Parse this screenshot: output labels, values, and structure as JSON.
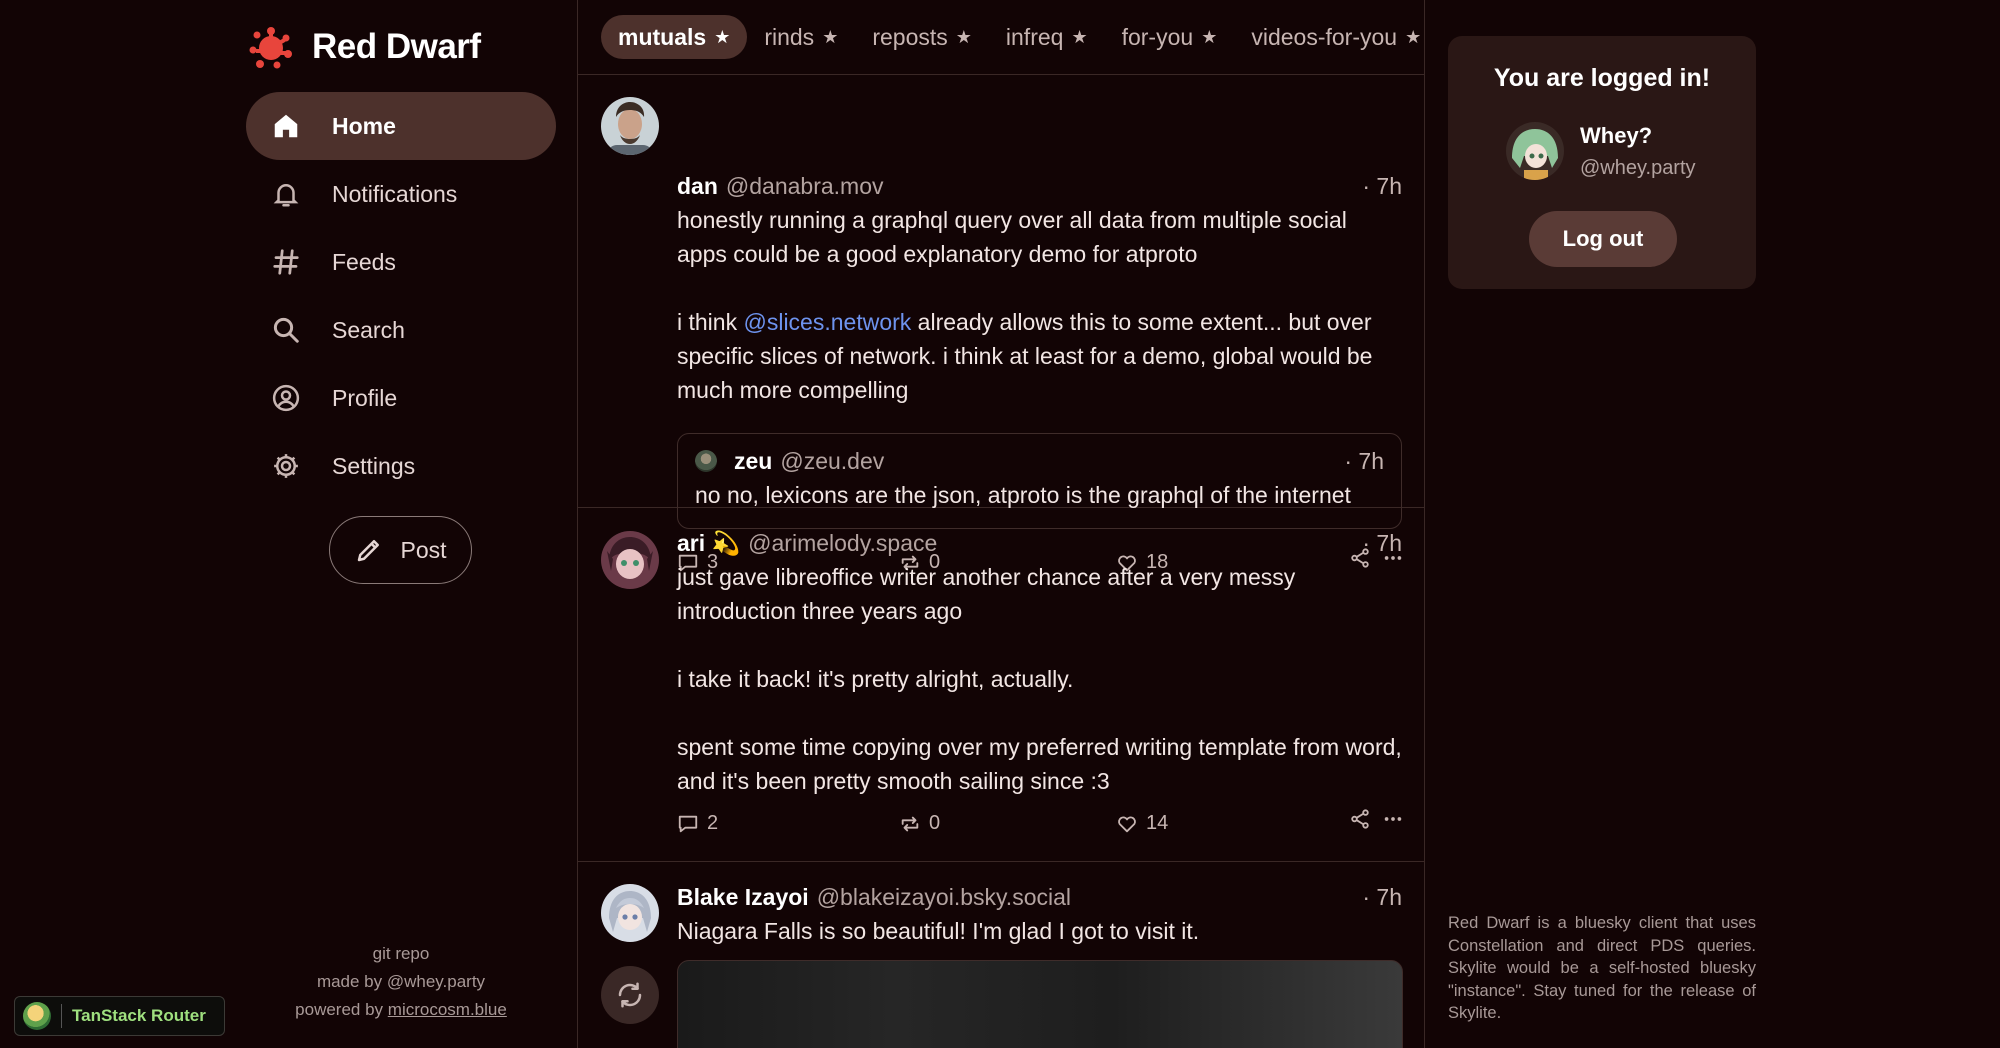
{
  "brand": {
    "name": "Red Dwarf"
  },
  "nav": {
    "items": [
      {
        "label": "Home",
        "icon": "home-icon",
        "active": true
      },
      {
        "label": "Notifications",
        "icon": "bell-icon"
      },
      {
        "label": "Feeds",
        "icon": "hashtag-icon"
      },
      {
        "label": "Search",
        "icon": "search-icon"
      },
      {
        "label": "Profile",
        "icon": "user-circle-icon"
      },
      {
        "label": "Settings",
        "icon": "gear-icon"
      }
    ],
    "post_label": "Post"
  },
  "footer": {
    "git_repo": "git repo",
    "made_by": "made by @whey.party",
    "powered_by": "powered by",
    "powered_link": "microcosm.blue"
  },
  "devtools": {
    "label": "TanStack Router"
  },
  "tabs": [
    {
      "label": "mutuals",
      "active": true
    },
    {
      "label": "rinds"
    },
    {
      "label": "reposts"
    },
    {
      "label": "infreq"
    },
    {
      "label": "for-you"
    },
    {
      "label": "videos-for-you"
    }
  ],
  "posts": [
    {
      "name": "dan",
      "handle": "@danabra.mov",
      "time": "· 7h",
      "text1": "honestly running a graphql query over all data from multiple social apps could be a good explanatory demo for atproto",
      "text2_pre": "i think ",
      "text2_mention": "@slices.network",
      "text2_post": " already allows this to some extent... but over specific slices of network. i think at least for a demo, global would be much more compelling",
      "quote": {
        "name": "zeu",
        "handle": "@zeu.dev",
        "time": "· 7h",
        "text": "no no, lexicons are the json, atproto is the graphql of the internet"
      },
      "replies": "3",
      "reposts": "0",
      "likes": "18"
    },
    {
      "name": "ari 💫",
      "handle": "@arimelody.space",
      "time": "· 7h",
      "text1": "just gave libreoffice writer another chance after a very messy introduction three years ago",
      "text2": "i take it back! it's pretty alright, actually.",
      "text3": "spent some time copying over my preferred writing template from word, and it's been pretty smooth sailing since :3",
      "replies": "2",
      "reposts": "0",
      "likes": "14"
    },
    {
      "name": "Blake Izayoi",
      "handle": "@blakeizayoi.bsky.social",
      "time": "· 7h",
      "text1": "Niagara Falls is so beautiful! I'm glad I got to visit it."
    }
  ],
  "login": {
    "title": "You are logged in!",
    "name": "Whey?",
    "handle": "@whey.party",
    "logout_label": "Log out"
  },
  "about": "Red Dwarf is a bluesky client that uses Constellation and direct PDS queries. Skylite would be a self-hosted bluesky \"instance\". Stay tuned for the release of Skylite.",
  "colors": {
    "background": "#120405",
    "accent_pill": "#4d312c",
    "card": "#2a1715",
    "mention": "#6e93ee",
    "logo": "#e8453c"
  }
}
